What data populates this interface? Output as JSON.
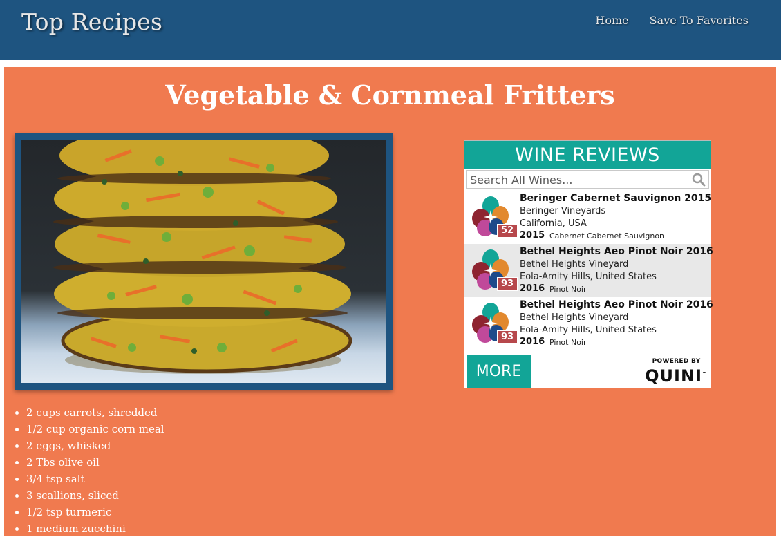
{
  "header": {
    "site_title": "Top Recipes",
    "nav": [
      {
        "label": "Home"
      },
      {
        "label": "Save To Favorites"
      }
    ],
    "color": "#1e5480"
  },
  "recipe": {
    "title": "Vegetable & Cornmeal Fritters",
    "ingredients": [
      "2 cups carrots, shredded",
      "1/2 cup organic corn meal",
      "2 eggs, whisked",
      "2 Tbs olive oil",
      "3/4 tsp salt",
      "3 scallions, sliced",
      "1/2 tsp turmeric",
      "1 medium zucchini"
    ],
    "background_color": "#f07a4f"
  },
  "wine_widget": {
    "header": "WINE REVIEWS",
    "search_placeholder": "Search All Wines...",
    "accent_color": "#12a597",
    "items": [
      {
        "name": "Beringer Cabernet Sauvignon 2015",
        "winery": "Beringer Vineyards",
        "region": "California, USA",
        "year": "2015",
        "variety": "Cabernet Cabernet Sauvignon",
        "score": "52",
        "icon": "quini-flower-icon"
      },
      {
        "name": "Bethel Heights Aeo Pinot Noir 2016",
        "winery": "Bethel Heights Vineyard",
        "region": "Eola-Amity Hills, United States",
        "year": "2016",
        "variety": "Pinot Noir",
        "score": "93",
        "icon": "quini-flower-icon"
      },
      {
        "name": "Bethel Heights Aeo Pinot Noir 2016",
        "winery": "Bethel Heights Vineyard",
        "region": "Eola-Amity Hills, United States",
        "year": "2016",
        "variety": "Pinot Noir",
        "score": "93",
        "icon": "quini-flower-icon"
      }
    ],
    "more_label": "MORE",
    "powered_by": "POWERED BY",
    "brand": "QUINI",
    "trademark": "™"
  }
}
